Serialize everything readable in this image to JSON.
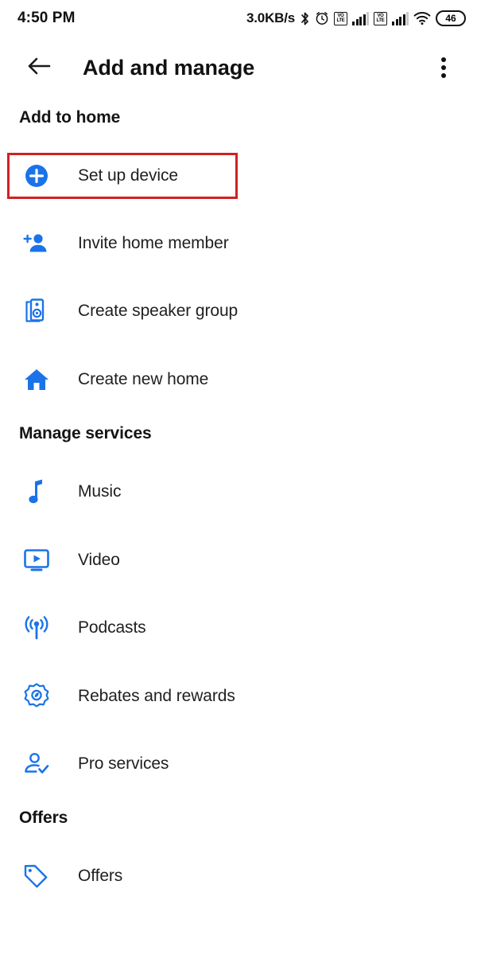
{
  "status_bar": {
    "time": "4:50 PM",
    "network_speed": "3.0KB/s",
    "bluetooth_icon": "bluetooth-icon",
    "alarm_icon": "alarm-icon",
    "sim1_volte_label": "VO\nLTE",
    "sim2_volte_label": "VO\nLTE",
    "wifi_icon": "wifi-icon",
    "battery_level": "46"
  },
  "app_bar": {
    "back_icon": "back-arrow-icon",
    "title": "Add and manage",
    "overflow_icon": "more-vert-icon"
  },
  "sections": [
    {
      "id": "add-to-home",
      "header": "Add to home",
      "items": [
        {
          "id": "set-up-device",
          "label": "Set up device",
          "icon": "add-circle-icon",
          "highlighted": true
        },
        {
          "id": "invite-home-member",
          "label": "Invite home member",
          "icon": "person-add-icon",
          "highlighted": false
        },
        {
          "id": "create-speaker-group",
          "label": "Create speaker group",
          "icon": "speaker-group-icon",
          "highlighted": false
        },
        {
          "id": "create-new-home",
          "label": "Create new home",
          "icon": "home-icon",
          "highlighted": false
        }
      ]
    },
    {
      "id": "manage-services",
      "header": "Manage services",
      "items": [
        {
          "id": "music",
          "label": "Music",
          "icon": "music-note-icon",
          "highlighted": false
        },
        {
          "id": "video",
          "label": "Video",
          "icon": "video-tv-icon",
          "highlighted": false
        },
        {
          "id": "podcasts",
          "label": "Podcasts",
          "icon": "podcast-icon",
          "highlighted": false
        },
        {
          "id": "rebates-and-rewards",
          "label": "Rebates and rewards",
          "icon": "rebate-seal-icon",
          "highlighted": false
        },
        {
          "id": "pro-services",
          "label": "Pro services",
          "icon": "person-check-icon",
          "highlighted": false
        }
      ]
    },
    {
      "id": "offers",
      "header": "Offers",
      "items": [
        {
          "id": "offers",
          "label": "Offers",
          "icon": "tag-icon",
          "highlighted": false
        }
      ]
    }
  ],
  "colors": {
    "accent_blue": "#1a73e8",
    "highlight_red": "#d32020",
    "text_primary": "#1f1f1f",
    "background": "#ffffff"
  }
}
